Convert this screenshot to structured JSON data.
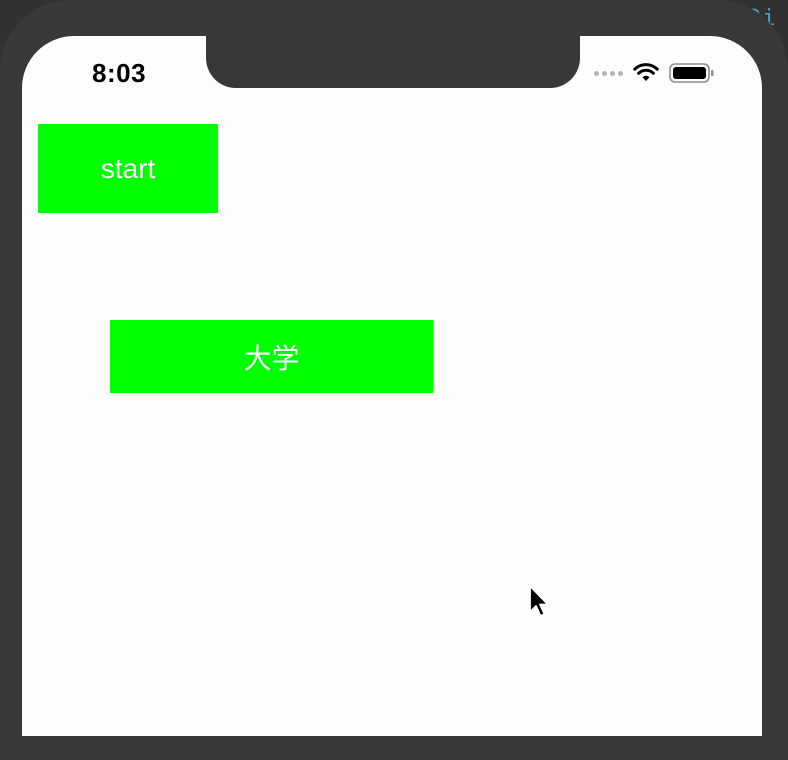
{
  "backdrop": {
    "code_fragment": "Di"
  },
  "status_bar": {
    "time": "8:03",
    "icons": [
      "signal-dots-icon",
      "wifi-icon",
      "battery-icon"
    ]
  },
  "buttons": {
    "start_label": "start",
    "daxue_label": "大学"
  },
  "colors": {
    "button_green": "#00ff00",
    "button_text": "#ffffff",
    "screen_bg": "#fdfdfd",
    "frame": "#383838",
    "code_blue": "#4a9fd6"
  }
}
